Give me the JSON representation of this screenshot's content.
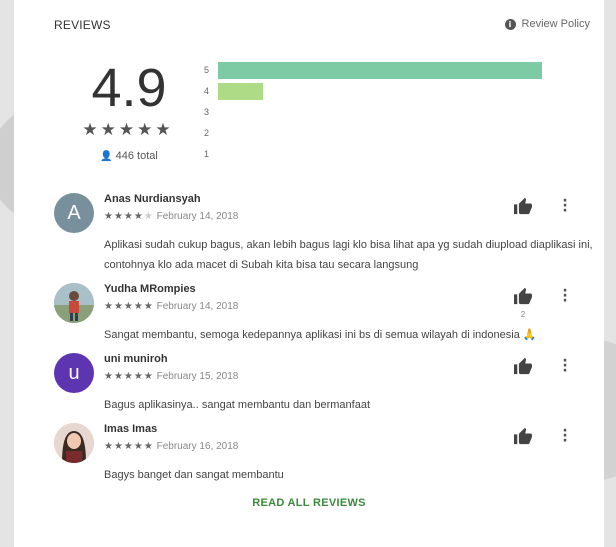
{
  "section": {
    "title": "REVIEWS",
    "policy_label": "Review Policy",
    "info_icon": "info-icon"
  },
  "summary": {
    "score": "4.9",
    "stars": "★★★★★",
    "total": "446 total",
    "person_icon": "person-icon"
  },
  "histogram": {
    "rows": [
      {
        "label": "5",
        "fraction": 1.0,
        "color": "#7ccba4"
      },
      {
        "label": "4",
        "fraction": 0.14,
        "color": "#aedb86"
      },
      {
        "label": "3",
        "fraction": 0,
        "color": "#f2d36b"
      },
      {
        "label": "2",
        "fraction": 0,
        "color": "#f2b46b"
      },
      {
        "label": "1",
        "fraction": 0,
        "color": "#f28a6b"
      }
    ]
  },
  "reviews": [
    {
      "name": "Anas Nurdiansyah",
      "stars_on": "★★★★",
      "stars_off": "★",
      "date": "February 14, 2018",
      "text": "Aplikasi sudah cukup bagus, akan lebih bagus lagi klo bisa lihat apa yg sudah diupload diap­likasi ini, contohnya klo ada macet di Subah kita bisa tau secara langsung",
      "avatar_letter": "A",
      "avatar_color": "#78909c",
      "likes": ""
    },
    {
      "name": "Yudha MRompies",
      "stars_on": "★★★★★",
      "stars_off": "",
      "date": "February 14, 2018",
      "text": "Sangat membantu, semoga kedepannya aplikasi ini bs di semua wilayah di indonesia 🙏",
      "avatar_letter": "",
      "avatar_color": "#9fb0a8",
      "likes": "2"
    },
    {
      "name": "uni muniroh",
      "stars_on": "★★★★★",
      "stars_off": "",
      "date": "February 15, 2018",
      "text": "Bagus aplikasinya.. sangat membantu dan bermanfaat",
      "avatar_letter": "u",
      "avatar_color": "#5e35b1",
      "likes": ""
    },
    {
      "name": "Imas Imas",
      "stars_on": "★★★★★",
      "stars_off": "",
      "date": "February 16, 2018",
      "text": "Bagys banget dan sangat membantu",
      "avatar_letter": "",
      "avatar_color": "#d9c7bf",
      "likes": ""
    }
  ],
  "footer": {
    "read_all": "READ ALL REVIEWS"
  },
  "icons": {
    "thumb": "thumbs-up-icon",
    "more": "more-vert-icon"
  },
  "colors": {
    "link_green": "#3a8a3a"
  }
}
